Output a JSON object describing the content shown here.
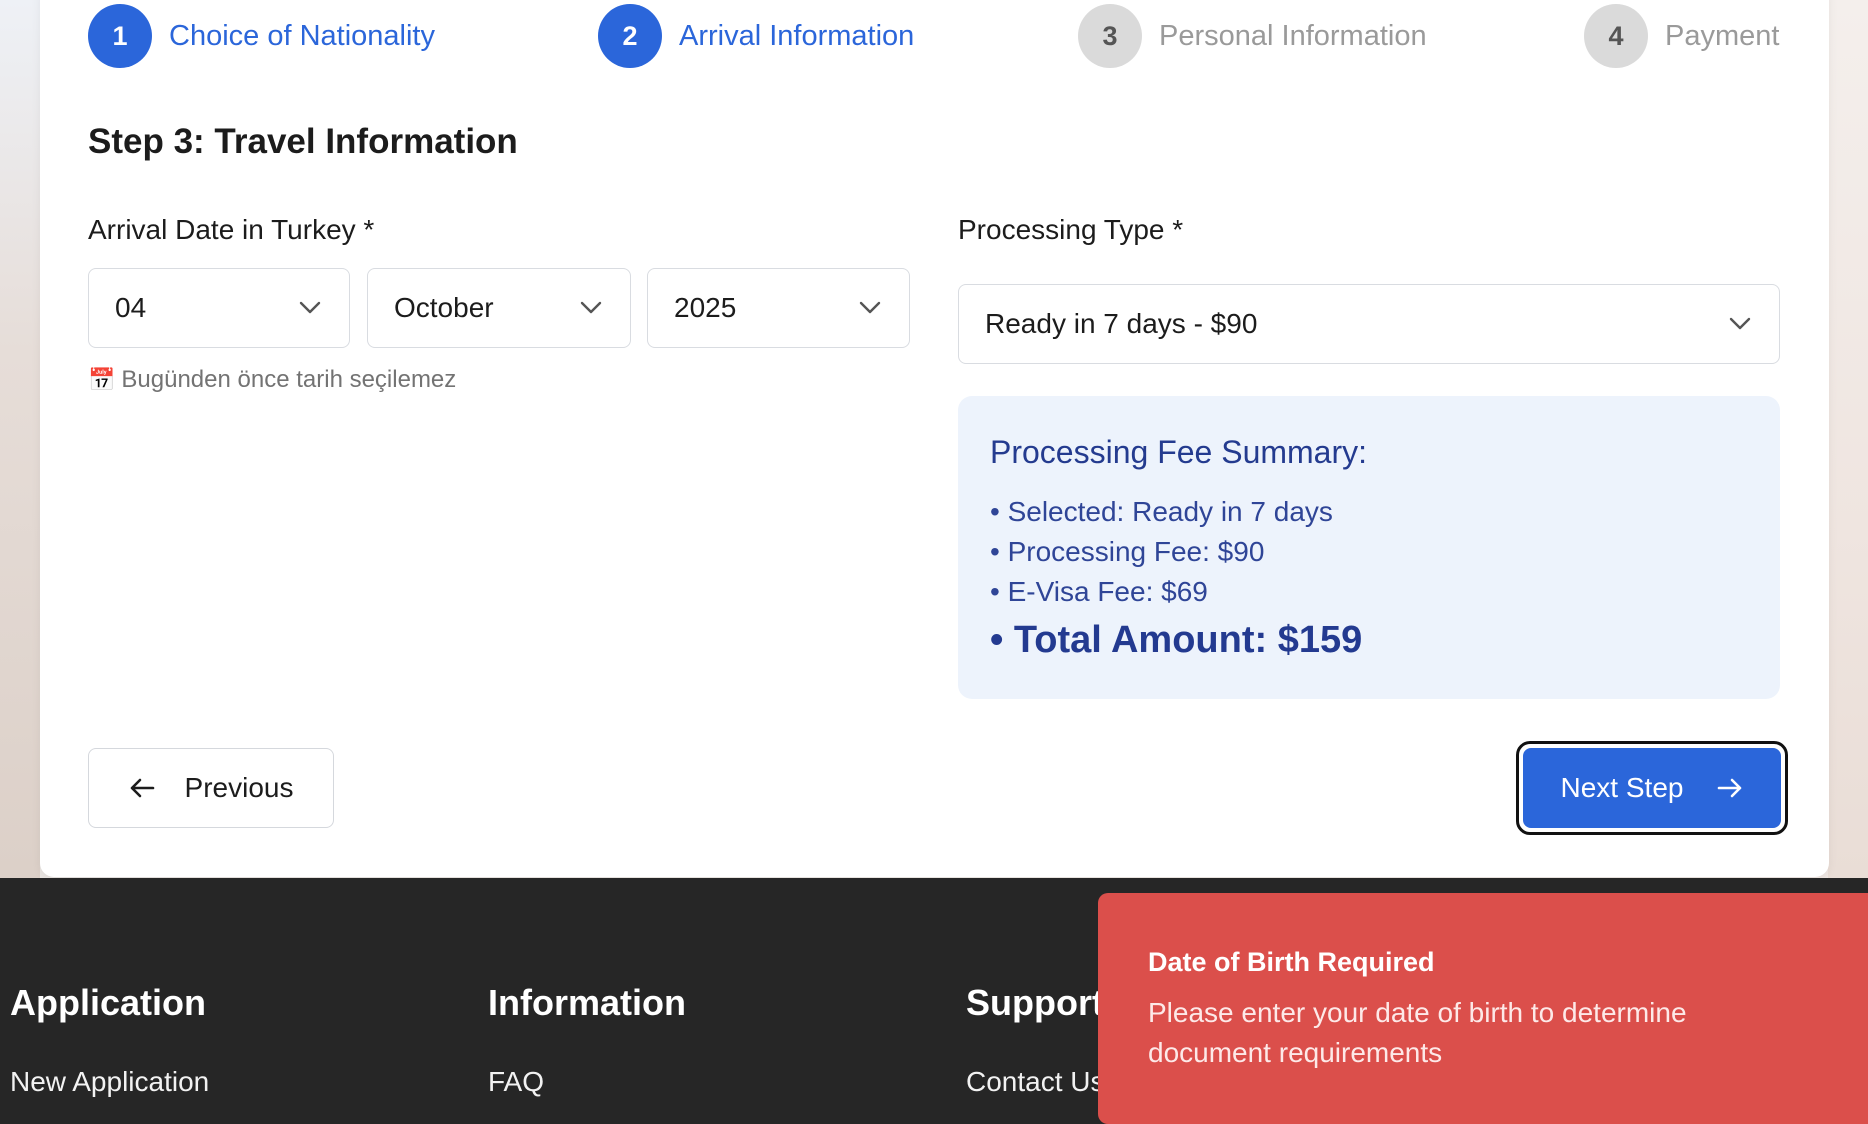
{
  "stepper": {
    "steps": [
      {
        "number": "1",
        "label": "Choice of Nationality",
        "state": "active"
      },
      {
        "number": "2",
        "label": "Arrival Information",
        "state": "active"
      },
      {
        "number": "3",
        "label": "Personal Information",
        "state": "inactive"
      },
      {
        "number": "4",
        "label": "Payment",
        "state": "inactive"
      }
    ]
  },
  "form": {
    "section_title": "Step 3: Travel Information",
    "arrival_label": "Arrival Date in Turkey *",
    "arrival_day": "04",
    "arrival_month": "October",
    "arrival_year": "2025",
    "hint_icon": "📅",
    "hint_text": "Bugünden önce tarih seçilemez",
    "processing_label": "Processing Type *",
    "processing_value": "Ready in 7 days - $90"
  },
  "summary": {
    "title": "Processing Fee Summary:",
    "items": [
      "• Selected: Ready in 7 days",
      "• Processing Fee: $90",
      "• E-Visa Fee: $69"
    ],
    "total": "• Total Amount: $159"
  },
  "buttons": {
    "previous": "Previous",
    "next": "Next Step"
  },
  "footer": {
    "columns": [
      {
        "heading": "Application",
        "link": "New Application"
      },
      {
        "heading": "Information",
        "link": "FAQ"
      },
      {
        "heading": "Support",
        "link": "Contact Us"
      }
    ]
  },
  "toast": {
    "title": "Date of Birth Required",
    "message": "Please enter your date of birth to determine document requirements"
  },
  "colors": {
    "primary": "#2b66da",
    "toast_bg": "#db4f4b",
    "footer_bg": "#262626",
    "summary_bg": "#edf3fc"
  }
}
